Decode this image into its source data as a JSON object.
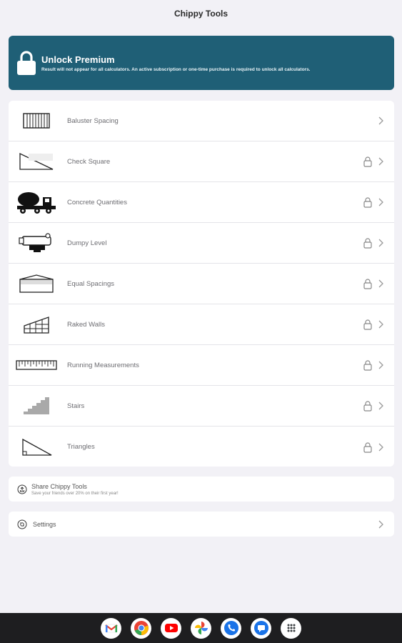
{
  "app": {
    "title": "Chippy Tools"
  },
  "premium": {
    "title": "Unlock Premium",
    "subtitle": "Result will not appear for all calculators. An active subscription or one-time purchase is required to unlock all calculators.",
    "color": "#1f5f76"
  },
  "tools": [
    {
      "label": "Baluster Spacing",
      "icon": "baluster-icon",
      "locked": false
    },
    {
      "label": "Check Square",
      "icon": "right-triangle-icon",
      "locked": true
    },
    {
      "label": "Concrete Quantities",
      "icon": "concrete-truck-icon",
      "locked": true
    },
    {
      "label": "Dumpy Level",
      "icon": "dumpy-level-icon",
      "locked": true
    },
    {
      "label": "Equal Spacings",
      "icon": "equal-spacing-icon",
      "locked": true
    },
    {
      "label": "Raked Walls",
      "icon": "raked-wall-icon",
      "locked": true
    },
    {
      "label": "Running Measurements",
      "icon": "tape-ruler-icon",
      "locked": true
    },
    {
      "label": "Stairs",
      "icon": "stairs-icon",
      "locked": true
    },
    {
      "label": "Triangles",
      "icon": "triangle-icon",
      "locked": true
    }
  ],
  "share": {
    "title": "Share Chippy Tools",
    "subtitle": "Save your friends over 20% on their first year!"
  },
  "settings": {
    "title": "Settings"
  },
  "dock": [
    "gmail-icon",
    "chrome-icon",
    "youtube-icon",
    "photos-icon",
    "phone-icon",
    "messages-icon",
    "apps-icon"
  ]
}
